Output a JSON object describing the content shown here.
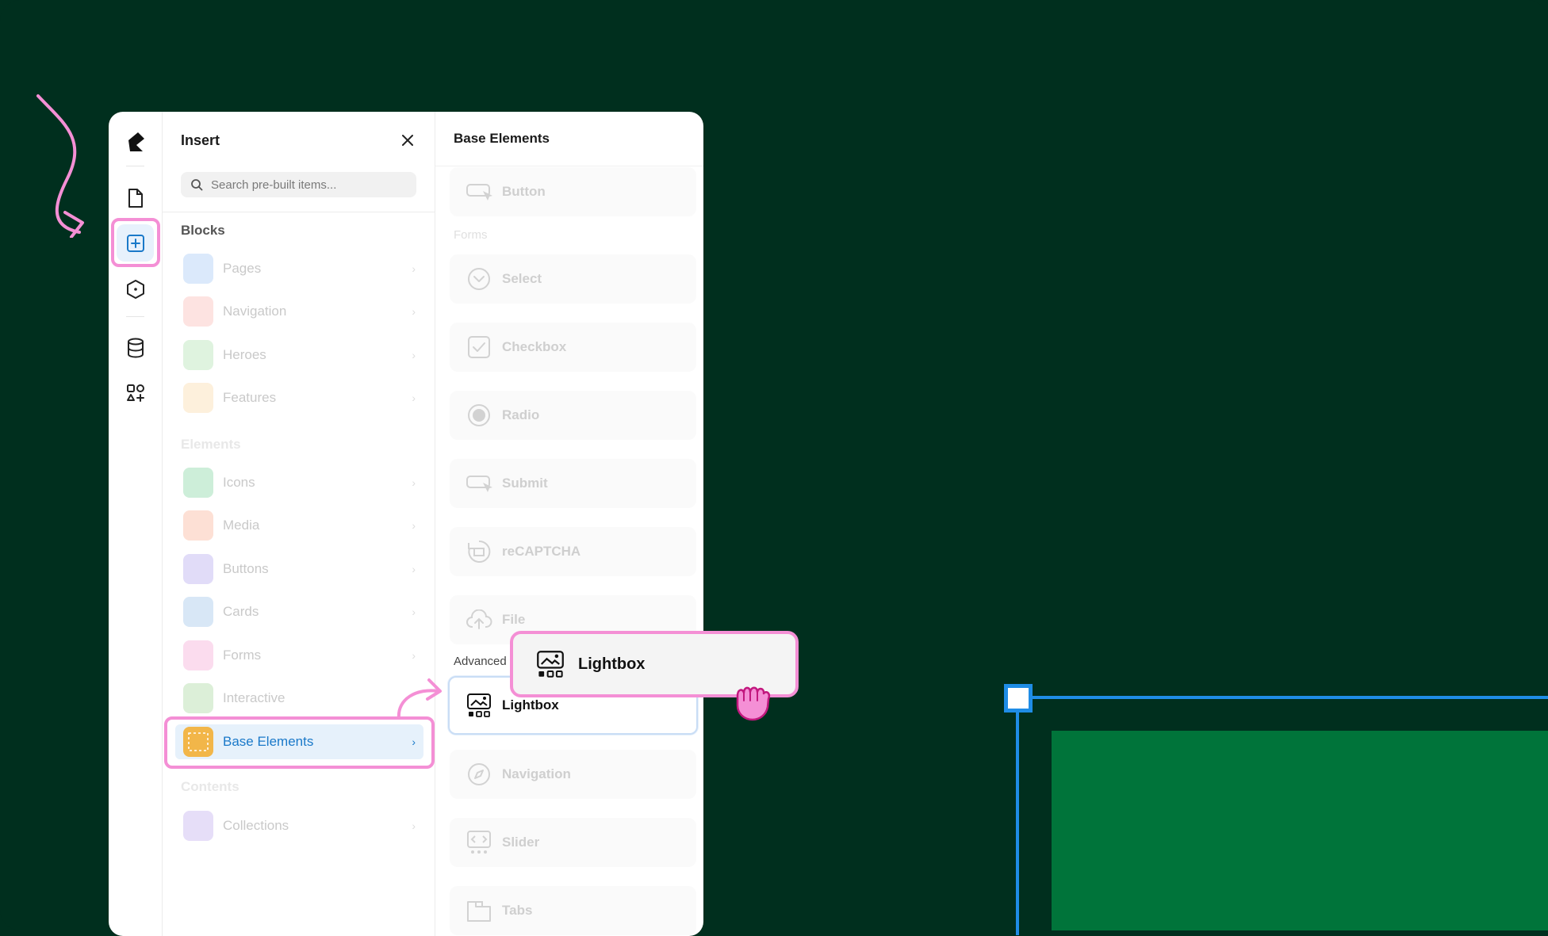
{
  "app": {
    "rail_icons": [
      "logo-icon",
      "page-icon",
      "insert-icon",
      "components-icon",
      "database-icon",
      "apps-icon"
    ],
    "active_rail": "insert-icon"
  },
  "insert_panel": {
    "title": "Insert",
    "search_placeholder": "Search pre-built items...",
    "sections": {
      "blocks": "Blocks",
      "elements": "Elements",
      "contents": "Contents"
    },
    "blocks": [
      {
        "label": "Pages",
        "color": "#dbe9fb"
      },
      {
        "label": "Navigation",
        "color": "#fde3e1"
      },
      {
        "label": "Heroes",
        "color": "#dff3df"
      },
      {
        "label": "Features",
        "color": "#fdf0dc"
      }
    ],
    "elements": [
      {
        "label": "Icons",
        "color": "#cdeed9"
      },
      {
        "label": "Media",
        "color": "#fde0d5"
      },
      {
        "label": "Buttons",
        "color": "#e1dcf8"
      },
      {
        "label": "Cards",
        "color": "#d8e7f6"
      },
      {
        "label": "Forms",
        "color": "#fbdcee"
      },
      {
        "label": "Interactive",
        "color": "#dcefd8"
      },
      {
        "label": "Base Elements",
        "color": "#f2b649",
        "selected": true
      }
    ],
    "contents": [
      {
        "label": "Collections",
        "color": "#e6def8"
      }
    ],
    "chevron": "›"
  },
  "base_elements": {
    "title": "Base Elements",
    "forms_label": "Forms",
    "advanced_label": "Advanced",
    "items_top": [
      {
        "label": "Button",
        "icon": "button-icon"
      }
    ],
    "forms": [
      {
        "label": "Select",
        "icon": "select-icon"
      },
      {
        "label": "Checkbox",
        "icon": "checkbox-icon"
      },
      {
        "label": "Radio",
        "icon": "radio-icon"
      },
      {
        "label": "Submit",
        "icon": "submit-icon"
      },
      {
        "label": "reCAPTCHA",
        "icon": "recaptcha-icon"
      },
      {
        "label": "File",
        "icon": "upload-icon"
      }
    ],
    "advanced": [
      {
        "label": "Lightbox",
        "icon": "lightbox-icon",
        "active": true
      },
      {
        "label": "Navigation",
        "icon": "compass-icon"
      },
      {
        "label": "Slider",
        "icon": "slider-icon"
      },
      {
        "label": "Tabs",
        "icon": "tabs-icon"
      }
    ]
  },
  "drag_preview": {
    "label": "Lightbox",
    "icon": "lightbox-icon"
  },
  "colors": {
    "background": "#002f1e",
    "highlight": "#f48fd5",
    "selection": "#1f8de6",
    "canvas_block": "#00743a"
  }
}
